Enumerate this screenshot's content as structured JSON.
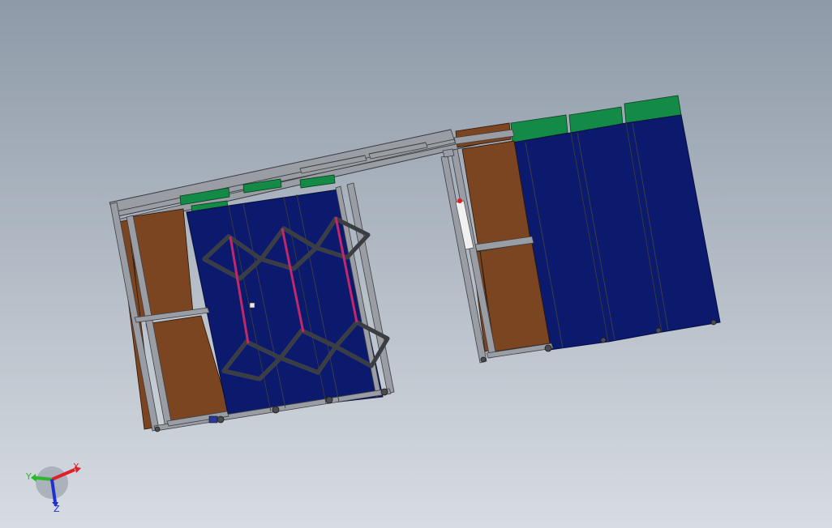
{
  "viewport": {
    "background_top": "#8e9aa8",
    "background_bottom": "#d7dce2"
  },
  "model": {
    "colors": {
      "frame": "#9a9ea4",
      "frame_edge": "#3c3f44",
      "panel_brown": "#7a4520",
      "panel_blue": "#0c1a6e",
      "panel_blue_edge": "#060d40",
      "panel_green": "#138a45",
      "accent_magenta": "#c0286a",
      "wheel": "#4a4c50"
    }
  },
  "triad": {
    "labels": {
      "x": "X",
      "y": "Y",
      "z": "Z"
    },
    "colors": {
      "x": "#e0202a",
      "y": "#2cb82c",
      "z": "#2030d0"
    }
  }
}
